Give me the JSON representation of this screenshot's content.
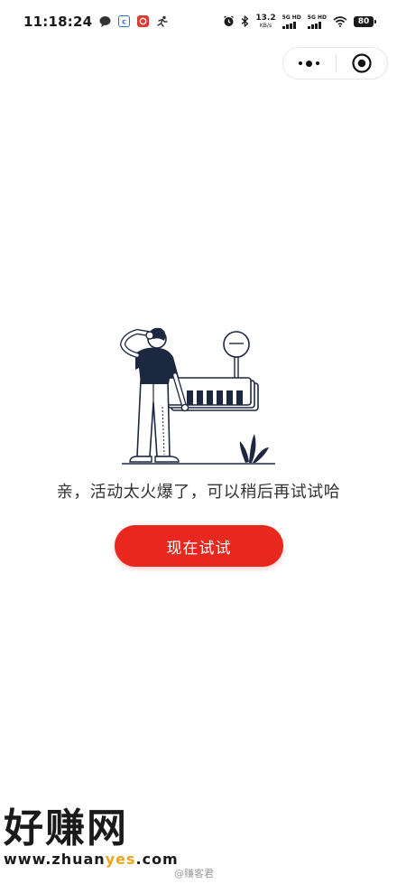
{
  "status_bar": {
    "time": "11:18:24",
    "net_speed": "13.2",
    "net_unit": "KB/s",
    "sig1_label": "5G HD",
    "sig2_label": "5G HD",
    "battery": "80"
  },
  "capsule": {
    "more_icon": "more-dots-icon",
    "close_icon": "target-close-icon"
  },
  "main": {
    "message": "亲，活动太火爆了，可以稍后再试试哈",
    "retry_button_label": "现在试试"
  },
  "watermark": {
    "logo_text": "好赚网",
    "url_prefix": "www.zhuan",
    "url_highlight": "yes",
    "url_suffix": ".com",
    "handle": "@赚客君"
  },
  "colors": {
    "accent": "#e8281f",
    "illustration_navy": "#1c2740",
    "text": "#333333"
  }
}
